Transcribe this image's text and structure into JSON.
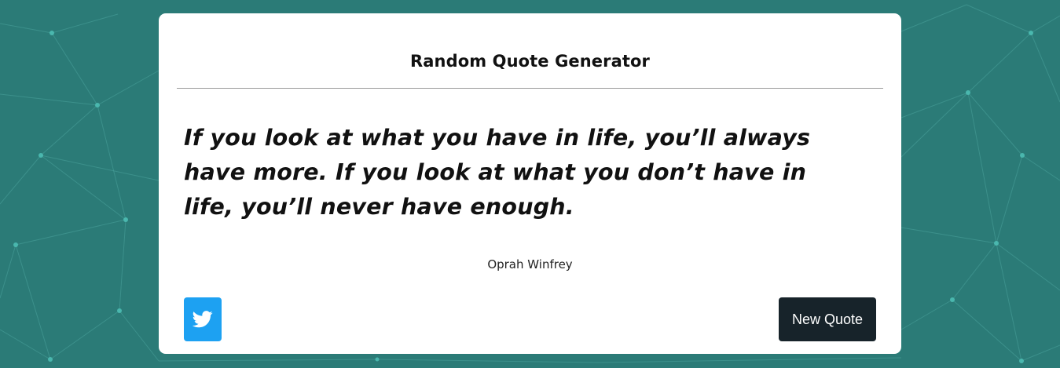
{
  "app": {
    "title": "Random Quote Generator"
  },
  "quote": {
    "text": "If you look at what you have in life, you’ll always have more. If you look at what you don’t have in life, you’ll never have enough.",
    "author": "Oprah Winfrey"
  },
  "actions": {
    "tweet_icon": "twitter-icon",
    "new_quote_label": "New Quote"
  },
  "colors": {
    "background": "#2b7b77",
    "card": "#ffffff",
    "twitter": "#1da1f2",
    "new_quote_button": "#17232a"
  }
}
